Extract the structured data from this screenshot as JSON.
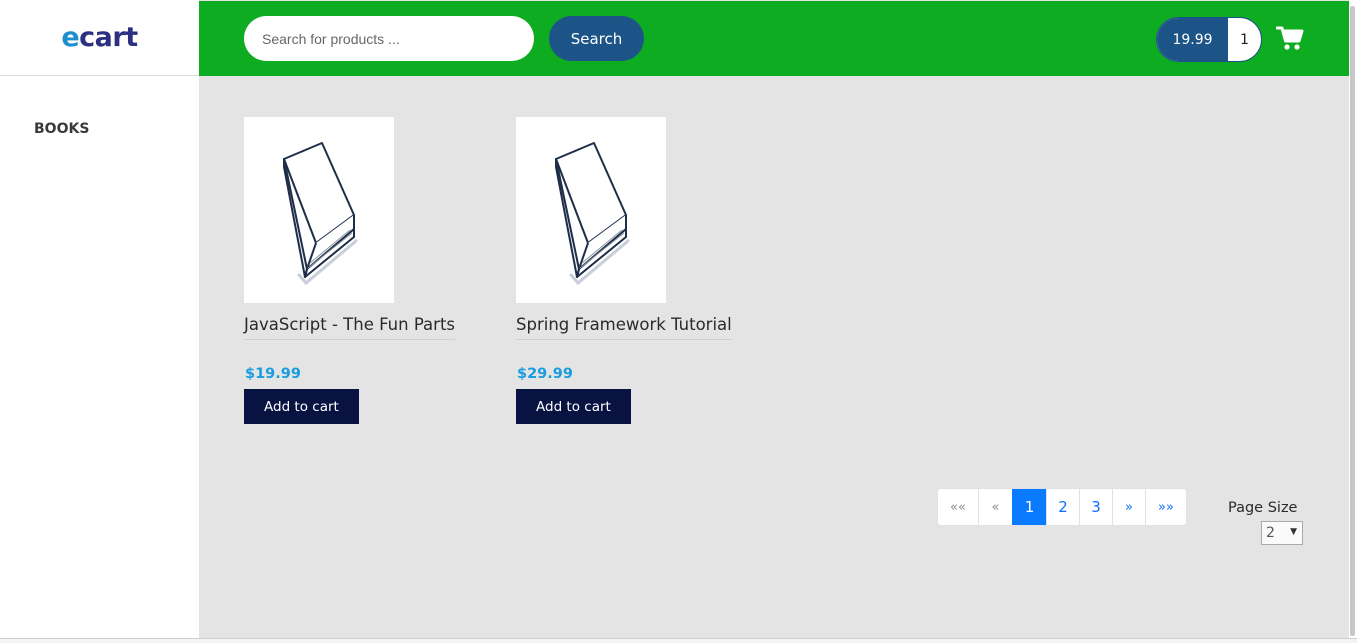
{
  "brand": {
    "logo_e": "e",
    "logo_rest": "cart"
  },
  "sidebar": {
    "items": [
      {
        "label": "BOOKS"
      }
    ]
  },
  "header": {
    "search_placeholder": "Search for products ...",
    "search_button": "Search",
    "cart_total": "19.99",
    "cart_quantity": "1"
  },
  "products": [
    {
      "title": "JavaScript - The Fun Parts",
      "price": "$19.99",
      "button": "Add to cart"
    },
    {
      "title": "Spring Framework Tutorial",
      "price": "$29.99",
      "button": "Add to cart"
    }
  ],
  "pagination": {
    "first": "««",
    "prev": "«",
    "pages": [
      "1",
      "2",
      "3"
    ],
    "active_page": "1",
    "next": "»",
    "last": "»»"
  },
  "page_size": {
    "label": "Page Size",
    "value": "2"
  },
  "colors": {
    "header_bg": "#0dac21",
    "primary_blue": "#1c5488",
    "button_navy": "#081342",
    "price_blue": "#1a9ce0",
    "active_page": "#0a7bff"
  },
  "icons": {
    "cart": "shopping-cart-icon",
    "book": "book-icon"
  }
}
